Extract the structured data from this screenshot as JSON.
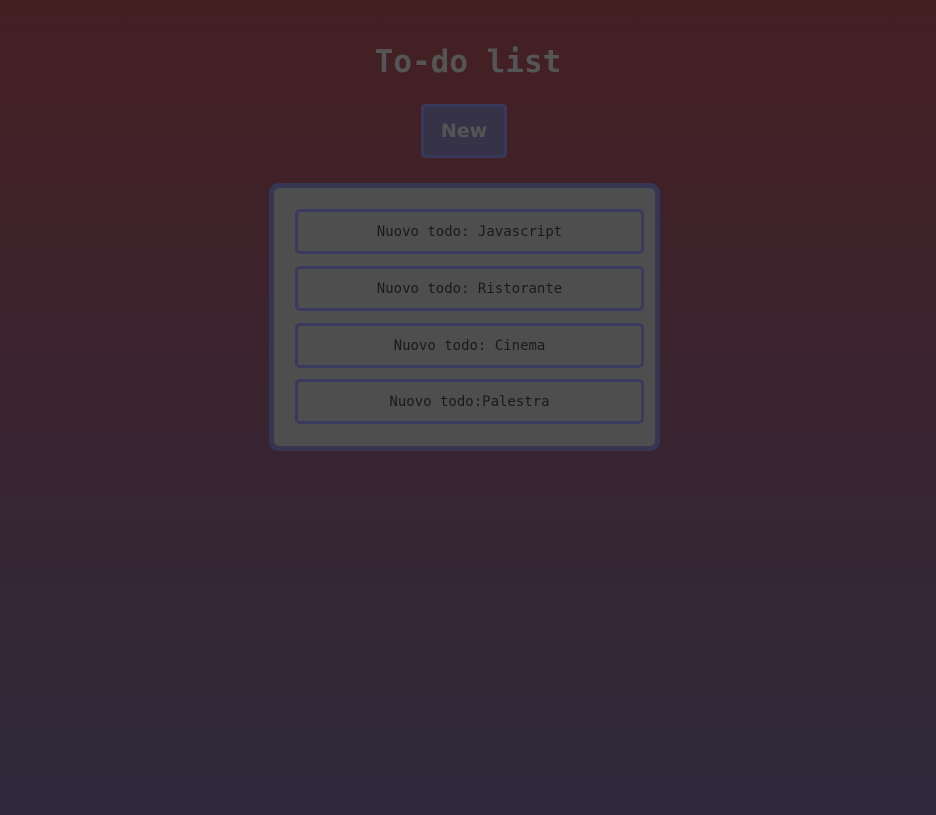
{
  "header": {
    "title": "To-do list"
  },
  "toolbar": {
    "new_label": "New"
  },
  "todos": [
    {
      "label": "Nuovo todo: Javascript"
    },
    {
      "label": "Nuovo todo: Ristorante"
    },
    {
      "label": "Nuovo todo: Cinema"
    },
    {
      "label": "Nuovo todo:Palestra"
    }
  ],
  "colors": {
    "background_top": "#441f22",
    "background_bottom": "#2e2a3c",
    "accent_border": "#38385a",
    "panel": "#4e4e4e"
  }
}
